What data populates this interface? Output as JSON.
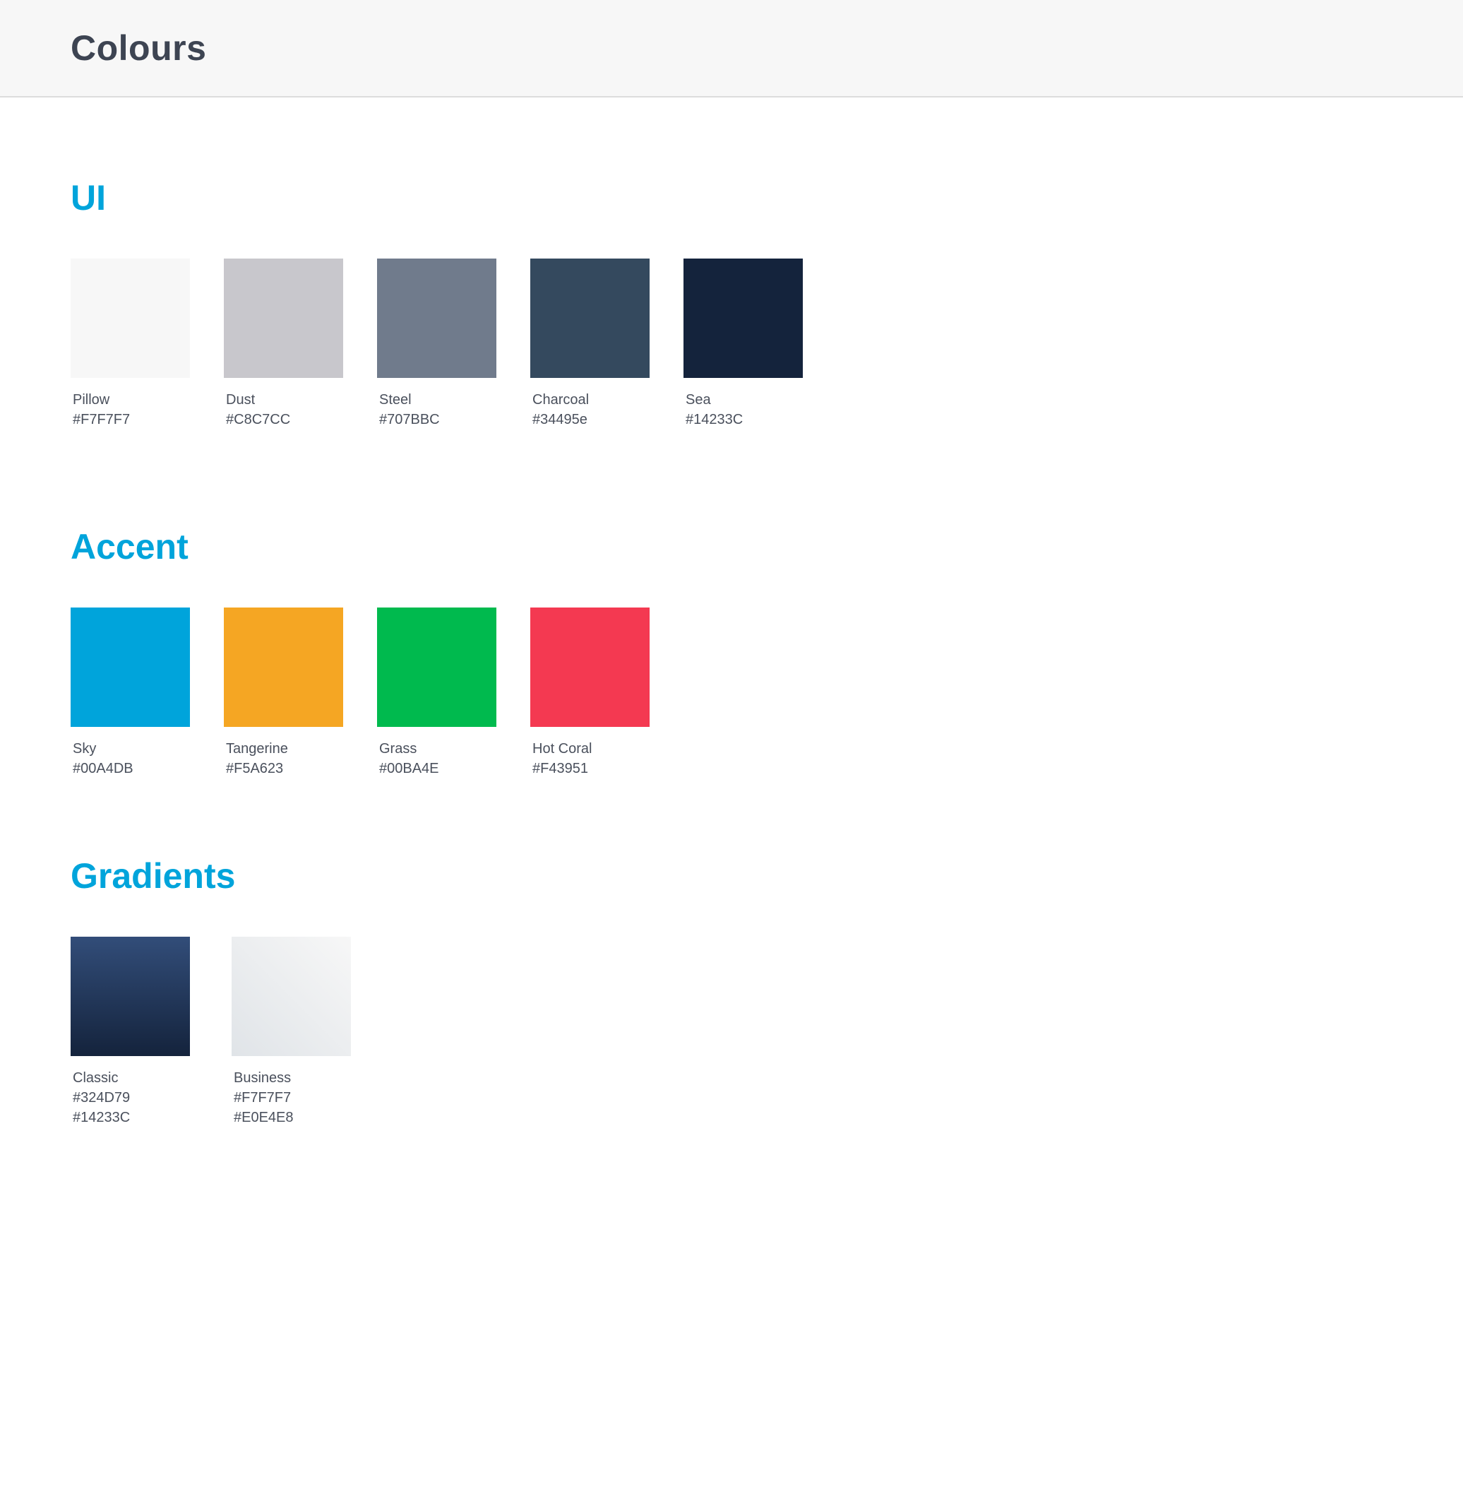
{
  "header": {
    "title": "Colours"
  },
  "sections": {
    "ui": {
      "title": "UI",
      "swatches": [
        {
          "name": "Pillow",
          "hex": "#F7F7F7",
          "color": "#F7F7F7"
        },
        {
          "name": "Dust",
          "hex": "#C8C7CC",
          "color": "#C8C7CC"
        },
        {
          "name": "Steel",
          "hex": "#707BBC",
          "color": "#707B8C"
        },
        {
          "name": "Charcoal",
          "hex": "#34495e",
          "color": "#34495E"
        },
        {
          "name": "Sea",
          "hex": "#14233C",
          "color": "#14233C"
        }
      ]
    },
    "accent": {
      "title": "Accent",
      "swatches": [
        {
          "name": "Sky",
          "hex": "#00A4DB",
          "color": "#00A4DB"
        },
        {
          "name": "Tangerine",
          "hex": "#F5A623",
          "color": "#F5A623"
        },
        {
          "name": "Grass",
          "hex": "#00BA4E",
          "color": "#00BA4E"
        },
        {
          "name": "Hot Coral",
          "hex": "#F43951",
          "color": "#F43951"
        }
      ]
    },
    "gradients": {
      "title": "Gradients",
      "swatches": [
        {
          "name": "Classic",
          "hex_start": "#324D79",
          "hex_end": "#14233C",
          "color_start": "#324D79",
          "color_end": "#14233C"
        },
        {
          "name": "Business",
          "hex_start": "#F7F7F7",
          "hex_end": "#E0E4E8",
          "color_start": "#F7F7F7",
          "color_end": "#E0E4E8"
        }
      ]
    }
  },
  "colors": {
    "heading_accent": "#00A4DB",
    "header_background": "#F7F7F7",
    "title_text": "#3D4452",
    "label_text": "#4A505C"
  }
}
